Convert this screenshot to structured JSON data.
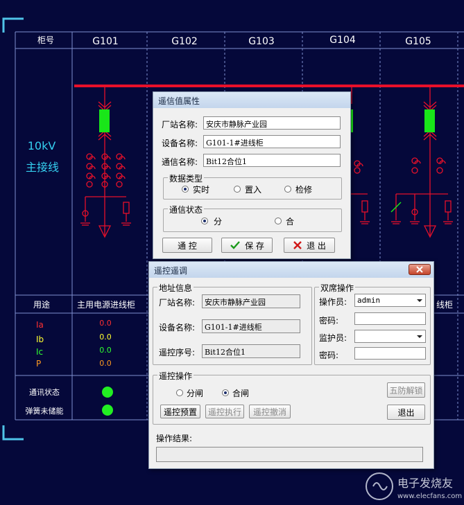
{
  "grid": {
    "header_label": "柜号",
    "cabinets": [
      "G101",
      "G102",
      "G103",
      "G104",
      "G105"
    ],
    "bus_label_voltage": "10kV",
    "bus_label_name": "主接线",
    "usage_label": "用途",
    "usage_g101": "主用电源进线柜",
    "usage_g105_partial": "线柜",
    "measure_labels": [
      "Ia",
      "Ib",
      "Ic",
      "P"
    ],
    "measure_values": [
      "0.0",
      "0.0",
      "0.0",
      "0.0"
    ],
    "status_labels": [
      "通讯状态",
      "弹簧未储能"
    ],
    "colors": {
      "bus": "#e8102a",
      "breaker": "#19e619",
      "grid": "#7e8fd0",
      "ia": "#ff3030",
      "ib": "#ffff30",
      "ic": "#30ff30",
      "p": "#ff9a20"
    }
  },
  "dialog1": {
    "title": "遥信值属性",
    "station_label": "厂站名称:",
    "station_value": "安庆市静脉产业园",
    "device_label": "设备名称:",
    "device_value": "G101-1#进线柜",
    "comm_label": "通信名称:",
    "comm_value": "Bit12合位1",
    "data_type_group": "数据类型",
    "data_type_options": [
      "实时",
      "置入",
      "检修"
    ],
    "comm_status_group": "通信状态",
    "comm_status_options": [
      "分",
      "合"
    ],
    "btn_control": "通 控",
    "btn_save": "保 存",
    "btn_exit": "退 出"
  },
  "dialog2": {
    "title": "遥控遥调",
    "addr_group": "地址信息",
    "station_label": "厂站名称:",
    "station_value": "安庆市静脉产业园",
    "device_label": "设备名称:",
    "device_value": "G101-1#进线柜",
    "seq_label": "遥控序号:",
    "seq_value": "Bit12合位1",
    "dual_group": "双席操作",
    "operator_label": "操作员:",
    "operator_value": "admin",
    "pwd_label": "密码:",
    "supervisor_label": "监护员:",
    "supervisor_value": "",
    "pwd2_label": "密码:",
    "ctrl_group": "遥控操作",
    "opt_open": "分闸",
    "opt_close": "合闸",
    "btn_unlock": "五防解锁",
    "btn_preset": "遥控预置",
    "btn_execute": "遥控执行",
    "btn_cancel": "遥控撤消",
    "btn_exit": "退出",
    "result_label": "操作结果:"
  },
  "watermark": {
    "name": "电子发烧友",
    "site": "www.elecfans.com"
  }
}
